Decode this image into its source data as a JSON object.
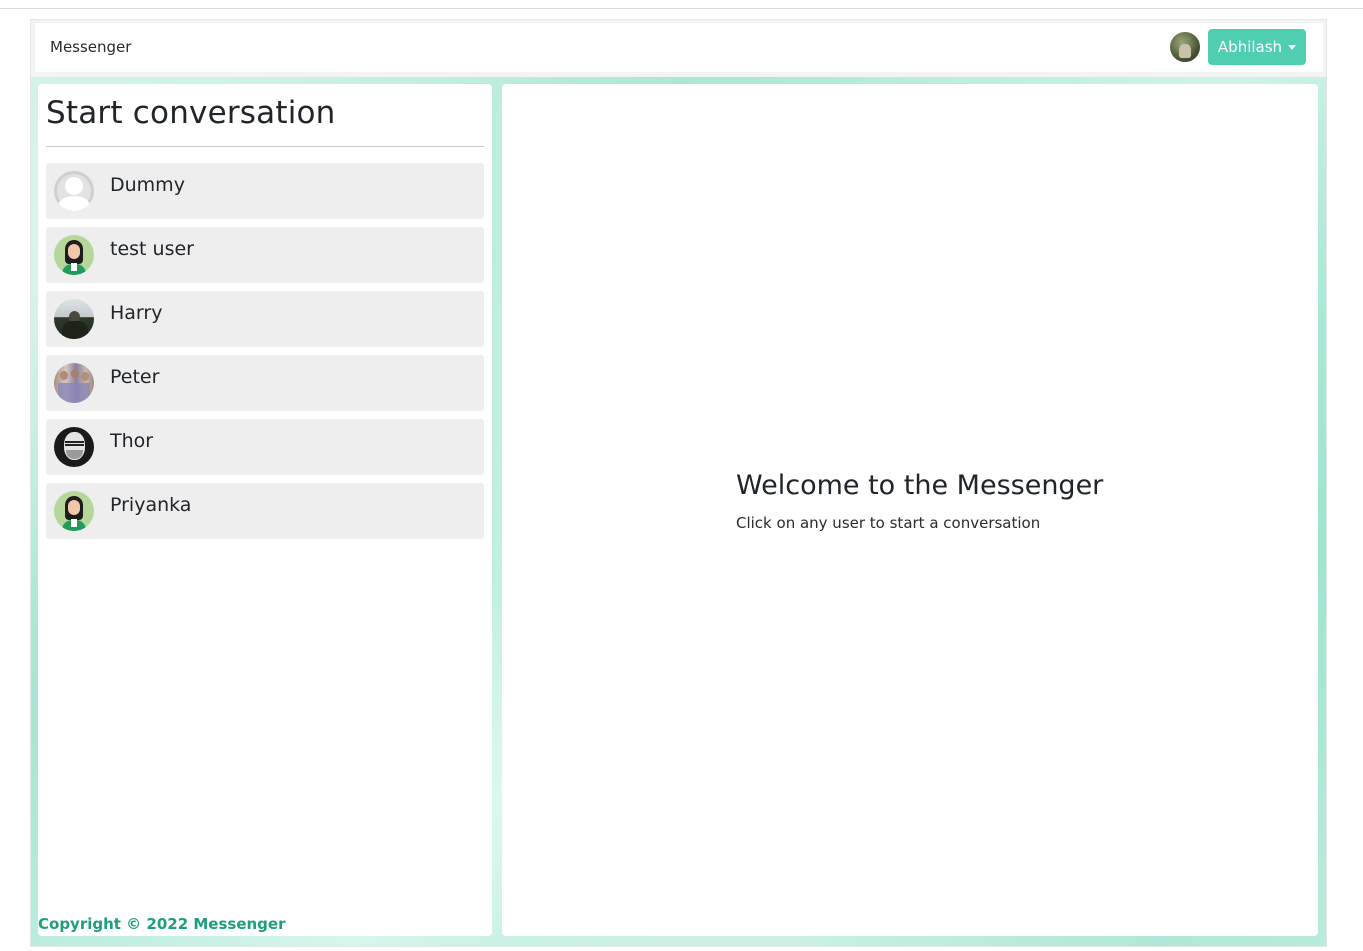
{
  "navbar": {
    "brand": "Messenger",
    "current_user": "Abhilash"
  },
  "sidebar": {
    "title": "Start conversation",
    "users": [
      {
        "name": "Dummy",
        "avatar": "default-avatar-icon"
      },
      {
        "name": "test user",
        "avatar": "female-avatar-icon"
      },
      {
        "name": "Harry",
        "avatar": "photo-avatar"
      },
      {
        "name": "Peter",
        "avatar": "photo-avatar"
      },
      {
        "name": "Thor",
        "avatar": "photo-avatar"
      },
      {
        "name": "Priyanka",
        "avatar": "female-avatar-icon"
      }
    ],
    "footer": "Copyright © 2022 Messenger"
  },
  "main": {
    "welcome_title": "Welcome to the Messenger",
    "welcome_subtitle": "Click on any user to start a conversation"
  },
  "colors": {
    "accent": "#4fcfb0",
    "footer_text": "#1f9e7f",
    "list_item_bg": "#eeeeee"
  }
}
